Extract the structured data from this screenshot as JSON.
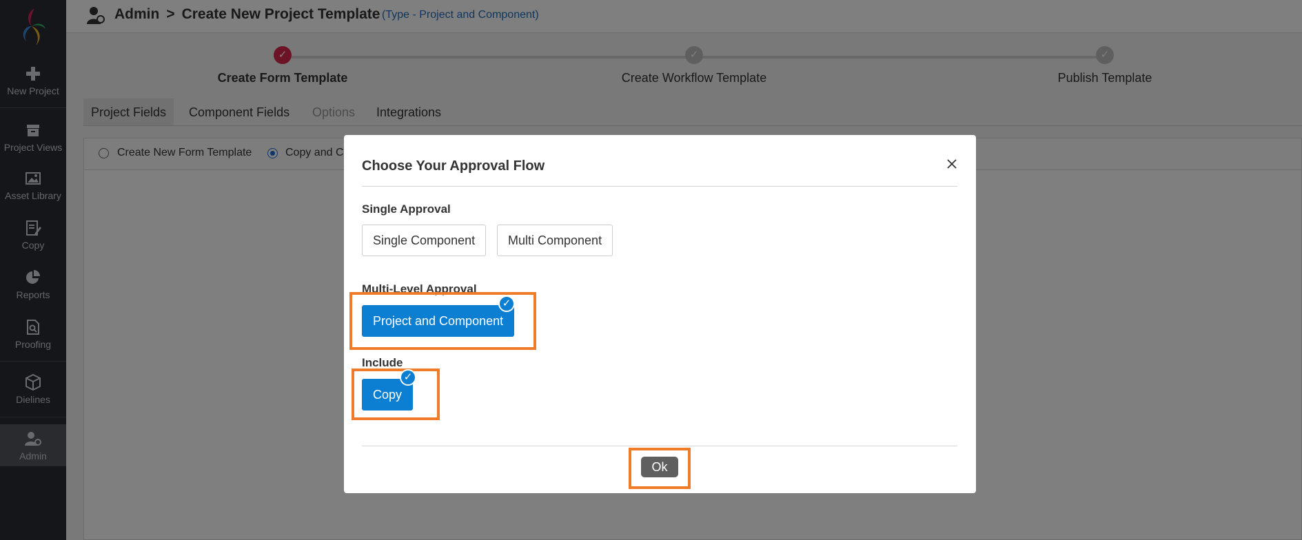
{
  "sidebar": {
    "items": [
      {
        "label": "New Project",
        "icon": "plus-icon"
      },
      {
        "label": "Project Views",
        "icon": "archive-box-icon"
      },
      {
        "label": "Asset Library",
        "icon": "image-icon"
      },
      {
        "label": "Copy",
        "icon": "edit-document-icon"
      },
      {
        "label": "Reports",
        "icon": "pie-chart-icon"
      },
      {
        "label": "Proofing",
        "icon": "document-search-icon"
      },
      {
        "label": "Dielines",
        "icon": "cube-icon"
      },
      {
        "label": "Admin",
        "icon": "admin-user-icon"
      }
    ],
    "active": "Admin"
  },
  "header": {
    "breadcrumb_root": "Admin",
    "breadcrumb_sep": ">",
    "breadcrumb_page": "Create New Project Template",
    "type_note": "(Type - Project and Component)"
  },
  "stepper": {
    "steps": [
      {
        "label": "Create Form Template",
        "state": "done"
      },
      {
        "label": "Create Workflow Template",
        "state": "pending"
      },
      {
        "label": "Publish Template",
        "state": "pending"
      }
    ]
  },
  "tabs": [
    {
      "label": "Project Fields",
      "state": "active"
    },
    {
      "label": "Component Fields",
      "state": "normal"
    },
    {
      "label": "Options",
      "state": "disabled"
    },
    {
      "label": "Integrations",
      "state": "normal"
    }
  ],
  "form_template_options": [
    {
      "label": "Create New Form Template",
      "selected": false
    },
    {
      "label": "Copy and C",
      "selected": true
    }
  ],
  "modal": {
    "title": "Choose Your Approval Flow",
    "single_approval_label": "Single Approval",
    "single_options": [
      "Single Component",
      "Multi Component"
    ],
    "multi_level_label": "Multi-Level Approval",
    "multi_level_option": "Project and Component",
    "include_label": "Include",
    "include_option": "Copy",
    "check_glyph": "✓",
    "ok_label": "Ok"
  },
  "colors": {
    "sidebar_bg": "#2a2d33",
    "accent_blue": "#0d7fd3",
    "step_done": "#d8284b",
    "highlight_orange": "#f07c2a",
    "ok_button": "#5f5f5f"
  }
}
